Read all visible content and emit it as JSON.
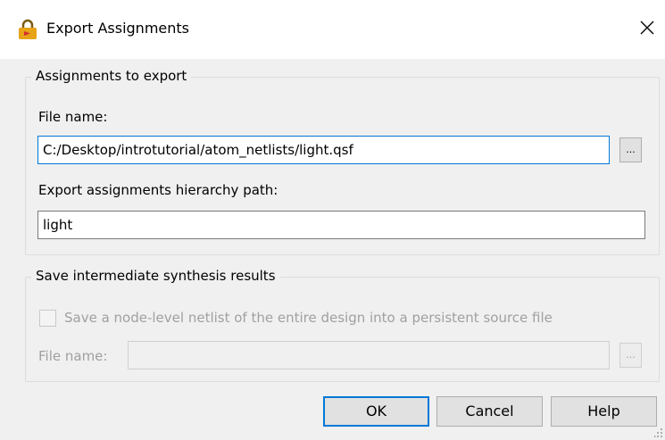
{
  "window": {
    "title": "Export Assignments",
    "icon": "lock-icon",
    "close_icon": "close-icon"
  },
  "assignments_group": {
    "legend": "Assignments to export",
    "file_name_label": "File name:",
    "file_name_value": "C:/Desktop/introtutorial/atom_netlists/light.qsf",
    "browse_label": "...",
    "hierarchy_label": "Export assignments hierarchy path:",
    "hierarchy_value": "light"
  },
  "synthesis_group": {
    "legend": "Save intermediate synthesis results",
    "checkbox_label": "Save a node-level netlist of the entire design into a persistent source file",
    "checkbox_checked": false,
    "file_name_label": "File name:",
    "file_name_value": "",
    "browse_label": "..."
  },
  "buttons": {
    "ok": "OK",
    "cancel": "Cancel",
    "help": "Help"
  },
  "colors": {
    "accent": "#0078d7",
    "dialog_bg": "#f0f0f0",
    "disabled_text": "#a0a0a0",
    "icon_orange": "#e8a317",
    "icon_red": "#d32f2f"
  }
}
